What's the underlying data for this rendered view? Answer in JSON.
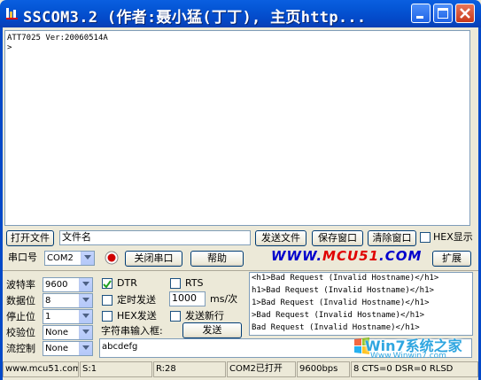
{
  "window": {
    "title": "SSCOM3.2 (作者:聂小猛(丁丁), 主页http...",
    "colors": {
      "titlebar": "#0556d6",
      "close": "#c8391b"
    }
  },
  "receive": {
    "lines": [
      "ATT7025 Ver:20060514A",
      ">"
    ]
  },
  "toolbar1": {
    "open_file": "打开文件",
    "filename": "文件名",
    "send_file": "发送文件",
    "save_window": "保存窗口",
    "clear_window": "清除窗口",
    "hex_display": "HEX显示"
  },
  "toolbar2": {
    "port_label": "串口号",
    "port_value": "COM2",
    "close_port": "关闭串口",
    "help": "帮助",
    "logo_a": "WWW.",
    "logo_b": "MCU51",
    "logo_c": ".COM",
    "expand": "扩展"
  },
  "settings": {
    "baud_label": "波特率",
    "baud_value": "9600",
    "databits_label": "数据位",
    "databits_value": "8",
    "stopbits_label": "停止位",
    "stopbits_value": "1",
    "parity_label": "校验位",
    "parity_value": "None",
    "flow_label": "流控制",
    "flow_value": "None"
  },
  "controls": {
    "dtr": "DTR",
    "rts": "RTS",
    "timed_send": "定时发送",
    "interval": "1000",
    "interval_unit": "ms/次",
    "hex_send": "HEX发送",
    "send_newline": "发送新行",
    "input_label": "字符串输入框:",
    "send": "发送",
    "input_value": "abcdefg"
  },
  "responses": [
    "<h1>Bad Request (Invalid Hostname)</h1>",
    "h1>Bad Request (Invalid Hostname)</h1>",
    "1>Bad Request (Invalid Hostname)</h1>",
    ">Bad Request (Invalid Hostname)</h1>",
    "Bad Request (Invalid Hostname)</h1>"
  ],
  "status": {
    "site": "www.mcu51.com",
    "sent": "S:1",
    "received": "R:28",
    "port_state": "COM2已打开",
    "baud": "9600bps",
    "signals": "8 CTS=0 DSR=0 RLSD"
  },
  "watermark": {
    "brand": "Win7系统之家",
    "url": "Www.Winwin7.com"
  }
}
